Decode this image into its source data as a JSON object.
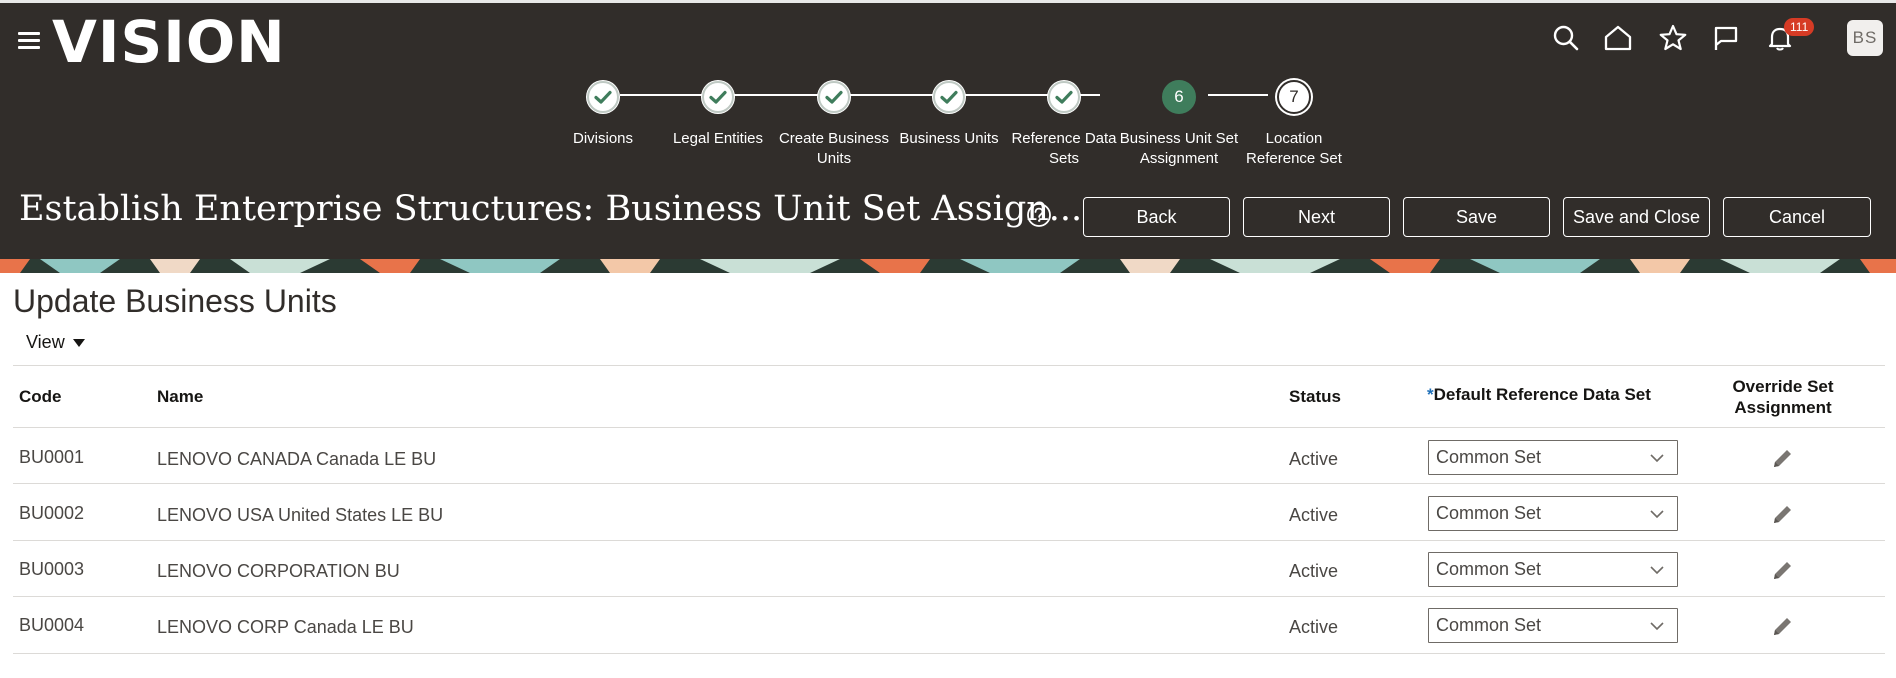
{
  "app": {
    "logo": "VISION"
  },
  "header": {
    "notifications_count": "111",
    "user_initials": "BS",
    "title": "Establish Enterprise Structures: Business Unit Set Assign...",
    "buttons": {
      "back": "Back",
      "next": "Next",
      "save": "Save",
      "save_close": "Save and Close",
      "cancel": "Cancel"
    }
  },
  "train": {
    "current_step": 6,
    "steps": [
      {
        "label": "Divisions",
        "state": "done"
      },
      {
        "label": "Legal Entities",
        "state": "done"
      },
      {
        "label": "Create Business Units",
        "state": "done"
      },
      {
        "label": "Business Units",
        "state": "done"
      },
      {
        "label": "Reference Data Sets",
        "state": "done"
      },
      {
        "label": "Business Unit Set Assignment",
        "state": "current",
        "number": "6"
      },
      {
        "label": "Location Reference Set",
        "state": "todo",
        "number": "7"
      }
    ]
  },
  "main": {
    "section_title": "Update Business Units",
    "view_menu": "View",
    "table": {
      "headers": {
        "code": "Code",
        "name": "Name",
        "status": "Status",
        "required_marker": "*",
        "default_set": "Default Reference Data Set",
        "override": "Override Set Assignment"
      },
      "rows": [
        {
          "code": "BU0001",
          "name": "LENOVO CANADA Canada LE BU",
          "status": "Active",
          "set": "Common Set"
        },
        {
          "code": "BU0002",
          "name": "LENOVO USA United States LE BU",
          "status": "Active",
          "set": "Common Set"
        },
        {
          "code": "BU0003",
          "name": "LENOVO CORPORATION BU",
          "status": "Active",
          "set": "Common Set"
        },
        {
          "code": "BU0004",
          "name": "LENOVO CORP Canada LE BU",
          "status": "Active",
          "set": "Common Set"
        }
      ]
    }
  },
  "colors": {
    "header_bg": "#312d2a",
    "step_done": "#3f7d5c",
    "step_current": "#3f7d5c",
    "badge": "#d63b25",
    "required": "#1e6fb8"
  },
  "icons": [
    "menu-icon",
    "search-icon",
    "home-icon",
    "star-icon",
    "flag-icon",
    "bell-icon",
    "help-icon",
    "check-icon",
    "chevron-down-icon",
    "pencil-icon"
  ]
}
